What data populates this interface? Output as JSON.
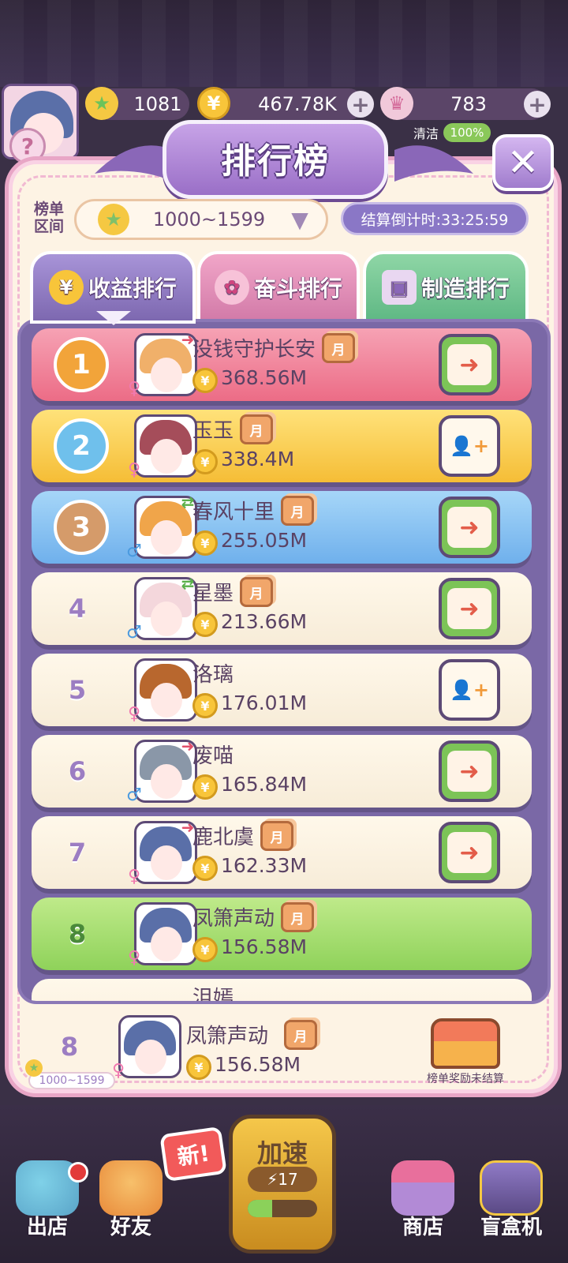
{
  "top_bar": {
    "stars": "1081",
    "coins": "467.78K",
    "crowns": "783",
    "clean_label": "清洁",
    "clean_value": "100%"
  },
  "icons": {
    "help": "?",
    "star": "★",
    "coin": "¥",
    "crown": "♛",
    "plus": "+",
    "close": "✕",
    "dropdown": "▼",
    "female": "♀",
    "male": "♂",
    "trend_up": "➜",
    "trend_swap": "⇄",
    "visit": "➜",
    "add_friend": "+"
  },
  "panel": {
    "title": "排行榜",
    "range_label": "榜单区间",
    "range_value": "1000~1599",
    "countdown": "结算倒计时:33:25:59"
  },
  "tabs": [
    {
      "label": "收益排行",
      "active": true
    },
    {
      "label": "奋斗排行",
      "active": false
    },
    {
      "label": "制造排行",
      "active": false
    }
  ],
  "month_badge": "月",
  "rows": [
    {
      "rank": "1",
      "name": "没钱守护长安",
      "value": "368.56M",
      "gender": "female",
      "trend": "up",
      "month": true,
      "action": "visit"
    },
    {
      "rank": "2",
      "name": "玉玉",
      "value": "338.4M",
      "gender": "female",
      "trend": "",
      "month": true,
      "action": "add"
    },
    {
      "rank": "3",
      "name": "春风十里",
      "value": "255.05M",
      "gender": "male",
      "trend": "swap",
      "month": true,
      "action": "visit"
    },
    {
      "rank": "4",
      "name": "星墨",
      "value": "213.66M",
      "gender": "male",
      "trend": "swap",
      "month": true,
      "action": "visit"
    },
    {
      "rank": "5",
      "name": "洛璃",
      "value": "176.01M",
      "gender": "female",
      "trend": "",
      "month": false,
      "action": "add"
    },
    {
      "rank": "6",
      "name": "废喵",
      "value": "165.84M",
      "gender": "male",
      "trend": "up",
      "month": false,
      "action": "visit"
    },
    {
      "rank": "7",
      "name": "鹿北虞",
      "value": "162.33M",
      "gender": "female",
      "trend": "up",
      "month": true,
      "action": "visit"
    },
    {
      "rank": "8",
      "name": "凤箫声动",
      "value": "156.58M",
      "gender": "female",
      "trend": "",
      "month": true,
      "action": "none"
    }
  ],
  "partial_row_name": "沮嫣",
  "my_row": {
    "rank": "8",
    "name": "凤箫声动",
    "value": "156.58M",
    "range": "1000~1599",
    "reward_label": "榜单奖励未结算"
  },
  "bottom_nav": {
    "out_store": "出店",
    "friends": "好友",
    "new_badge": "新!",
    "speed_label": "加速",
    "speed_count": "17",
    "speed_progress": 0.35,
    "shop": "商店",
    "blind_box": "盲盒机"
  }
}
